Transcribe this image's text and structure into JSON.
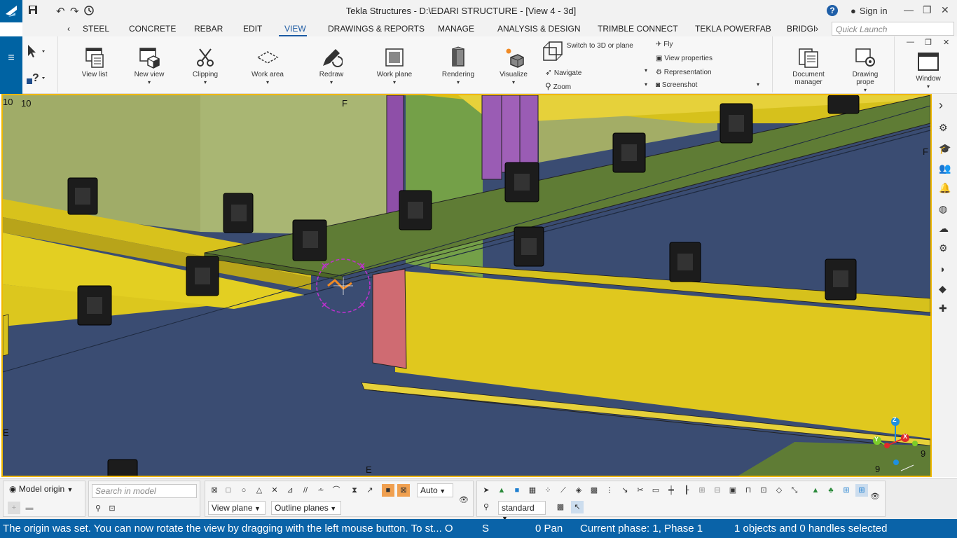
{
  "titlebar": {
    "title": "Tekla Structures - D:\\EDARI STRUCTURE  - [View 4 - 3d]",
    "sign_in": "Sign in",
    "help": "?"
  },
  "menu": {
    "tabs": [
      "STEEL",
      "CONCRETE",
      "REBAR",
      "EDIT",
      "VIEW",
      "DRAWINGS & REPORTS",
      "MANAGE",
      "ANALYSIS & DESIGN",
      "TRIMBLE CONNECT",
      "TEKLA POWERFAB",
      "BRIDGI"
    ],
    "active_tab": "VIEW",
    "quick_launch_placeholder": "Quick Launch"
  },
  "ribbon": {
    "view_list": "View list",
    "new_view": "New view",
    "clipping": "Clipping",
    "work_area": "Work area",
    "redraw": "Redraw",
    "work_plane": "Work plane",
    "rendering": "Rendering",
    "visualize": "Visualize",
    "switch_3d": "Switch to 3D or plane",
    "navigate": "Navigate",
    "zoom": "Zoom",
    "fly": "Fly",
    "view_properties": "View properties",
    "representation": "Representation",
    "screenshot": "Screenshot",
    "document_manager": "Document manager",
    "drawing_properties": "Drawing prope",
    "window": "Window"
  },
  "viewport": {
    "grid_labels": {
      "top_left_a": "10",
      "top_left_b": "10",
      "top_f": "F",
      "right_f": "F",
      "left_e": "E",
      "bottom_e": "E",
      "bottom_right_9a": "9",
      "bottom_right_9b": "9"
    },
    "axes": {
      "z": "Z",
      "y": "Y",
      "x": "X"
    },
    "colors": {
      "deck_blue": "#3a4c72",
      "beam_yellow": "#e0c81e",
      "flange_green": "#5f7c35",
      "wall_olive": "#a6b36e",
      "column_purple": "#8e4fa8",
      "plate_red": "#cf6b72",
      "clip_black": "#1c1c1c",
      "selection_border": "#f0b800"
    }
  },
  "bottom": {
    "model_origin": "Model origin",
    "search_placeholder": "Search in model",
    "auto": "Auto",
    "view_plane": "View plane",
    "outline_planes": "Outline planes",
    "standard": "standard"
  },
  "statusbar": {
    "message": "The origin was set. You can now rotate the view by dragging with the left mouse button. To st... O",
    "snap": "S",
    "pan": "0  Pan",
    "phase": "Current phase: 1, Phase 1",
    "selection": "1 objects and 0 handles selected"
  }
}
